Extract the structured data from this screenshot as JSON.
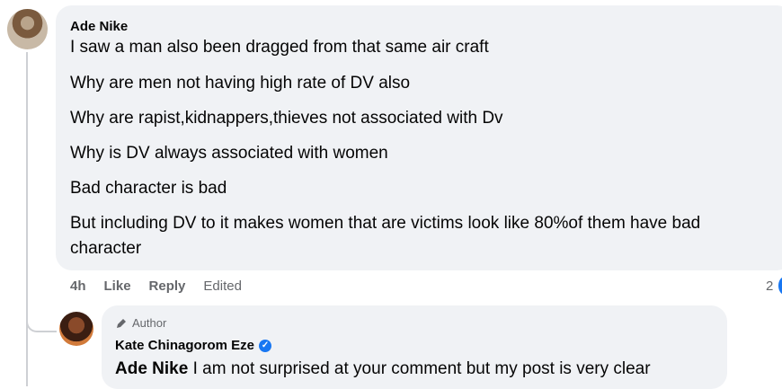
{
  "comment": {
    "author": "Ade Nike",
    "lines": [
      "I saw a man also been dragged from that same air craft",
      "Why are men not having high rate of DV also",
      "Why are rapist,kidnappers,thieves not associated with Dv",
      "Why is DV always associated with women",
      "Bad character is bad",
      "But including DV to it makes women that are victims look like 80%of them have bad",
      "character"
    ],
    "time": "4h",
    "like_label": "Like",
    "reply_label": "Reply",
    "edited_label": "Edited",
    "reaction_count": "2"
  },
  "reply": {
    "badge": "Author",
    "author": "Kate Chinagorom Eze",
    "mention": "Ade Nike",
    "text": " I am not surprised at your comment but my post is very clear"
  }
}
